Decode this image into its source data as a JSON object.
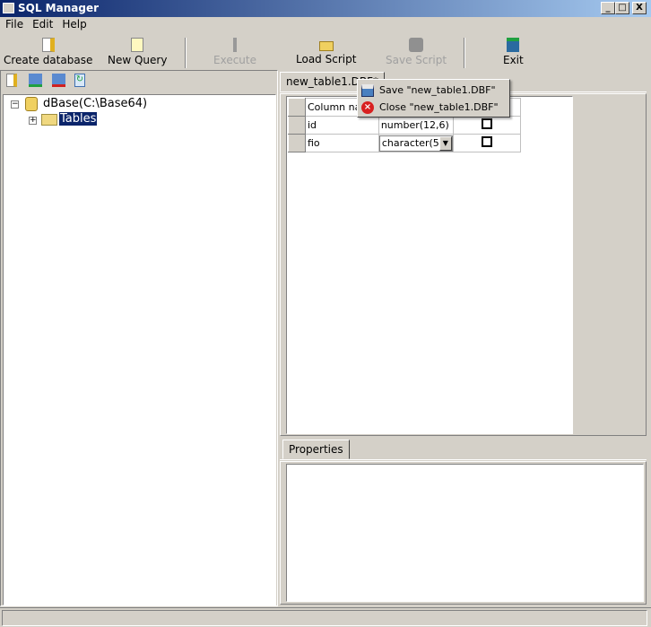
{
  "window": {
    "title": "SQL Manager",
    "min": "_",
    "max": "□",
    "close": "X"
  },
  "menu": [
    "File",
    "Edit",
    "Help"
  ],
  "toolbar": {
    "create_database": "Create database",
    "new_query": "New Query",
    "execute": "Execute",
    "load_script": "Load Script",
    "save_script": "Save Script",
    "exit": "Exit"
  },
  "tree": {
    "root": "dBase(C:\\Base64)",
    "tables": "Tables"
  },
  "editor": {
    "tab": "new_table1.DBF*",
    "header": "Column name",
    "rows": [
      {
        "name": "id",
        "type": "number(12,6)"
      },
      {
        "name": "fio",
        "type": "character(5"
      }
    ]
  },
  "context_menu": {
    "save": "Save \"new_table1.DBF\"",
    "close": "Close \"new_table1.DBF\""
  },
  "properties": {
    "tab": "Properties"
  }
}
